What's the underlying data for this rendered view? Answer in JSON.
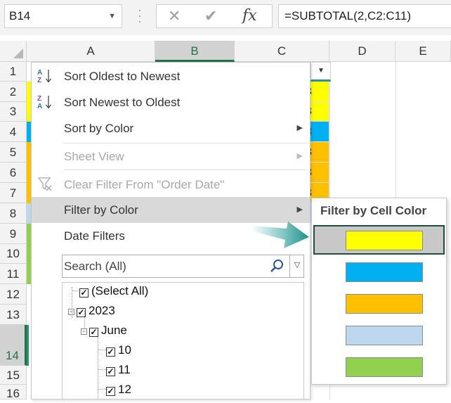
{
  "formula_bar": {
    "name_box": "B14",
    "cancel_glyph": "✕",
    "enter_glyph": "✔",
    "fx_glyph": "fx",
    "formula": "=SUBTOTAL(2,C2:C11)"
  },
  "columns": [
    "A",
    "B",
    "C",
    "D",
    "E"
  ],
  "rows": [
    "1",
    "2",
    "3",
    "4",
    "5",
    "6",
    "7",
    "8",
    "9",
    "10",
    "11",
    "12",
    "13",
    "14",
    "15",
    "16"
  ],
  "visible_cell_fragments": [
    "3",
    "3",
    "3",
    "3",
    "3",
    "3"
  ],
  "menu": {
    "sort_asc": "Sort Oldest to Newest",
    "sort_desc": "Sort Newest to Oldest",
    "sort_color": "Sort by Color",
    "sheet_view": "Sheet View",
    "clear_filter": "Clear Filter From \"Order Date\"",
    "filter_color": "Filter by Color",
    "date_filters": "Date Filters",
    "search_placeholder": "Search (All)",
    "tree": {
      "select_all": "(Select All)",
      "year": "2023",
      "month": "June",
      "days": [
        "10",
        "11",
        "12"
      ]
    }
  },
  "submenu": {
    "header": "Filter by Cell Color",
    "colors": [
      "#FFFF00",
      "#00B0F0",
      "#FFC000",
      "#BDD7EE",
      "#92D050"
    ]
  },
  "row_colors": [
    "#FFFF00",
    "#FFFF00",
    "#00B0F0",
    "#FFC000",
    "#FFC000",
    "#FFC000",
    "#BDD7EE",
    "#92D050",
    "#92D050",
    "#92D050"
  ],
  "accent": "#217346"
}
